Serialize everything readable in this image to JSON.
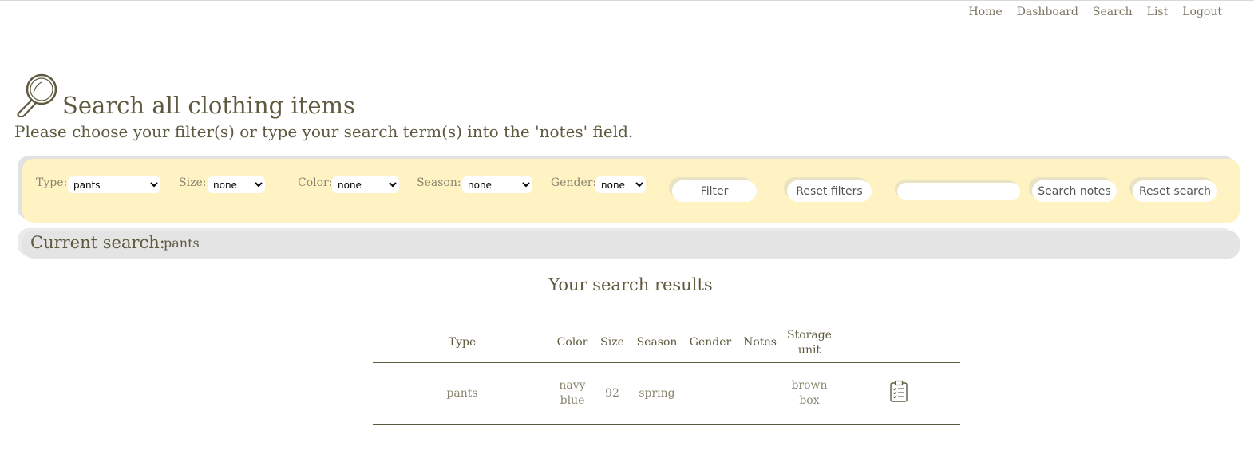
{
  "nav": {
    "items": [
      {
        "label": "Home"
      },
      {
        "label": "Dashboard"
      },
      {
        "label": "Search"
      },
      {
        "label": "List"
      },
      {
        "label": "Logout"
      }
    ]
  },
  "header": {
    "title": "Search all clothing items",
    "subtitle": "Please choose your filter(s) or type your search term(s) into the 'notes' field."
  },
  "filters": {
    "type_label": "Type:",
    "type_value": "pants",
    "size_label": "Size:",
    "size_value": "none",
    "color_label": "Color:",
    "color_value": "none",
    "season_label": "Season:",
    "season_value": "none",
    "gender_label": "Gender:",
    "gender_value": "none",
    "filter_button": "Filter",
    "reset_filters_button": "Reset filters",
    "notes_value": "",
    "search_notes_button": "Search notes",
    "reset_search_button": "Reset search"
  },
  "current_search": {
    "label": "Current search:",
    "value": "pants"
  },
  "results": {
    "title": "Your search results",
    "columns": [
      "Type",
      "Color",
      "Size",
      "Season",
      "Gender",
      "Notes",
      "Storage unit"
    ],
    "rows": [
      {
        "type": "pants",
        "color": "navy blue",
        "size": "92",
        "season": "spring",
        "gender": "",
        "notes": "",
        "storage": "brown box",
        "action_icon": "clipboard-checklist-icon"
      }
    ]
  },
  "colors": {
    "filter_bar_bg": "#fff3c3",
    "current_search_bg": "#e4e4e4",
    "text": "#5e5a3f"
  }
}
